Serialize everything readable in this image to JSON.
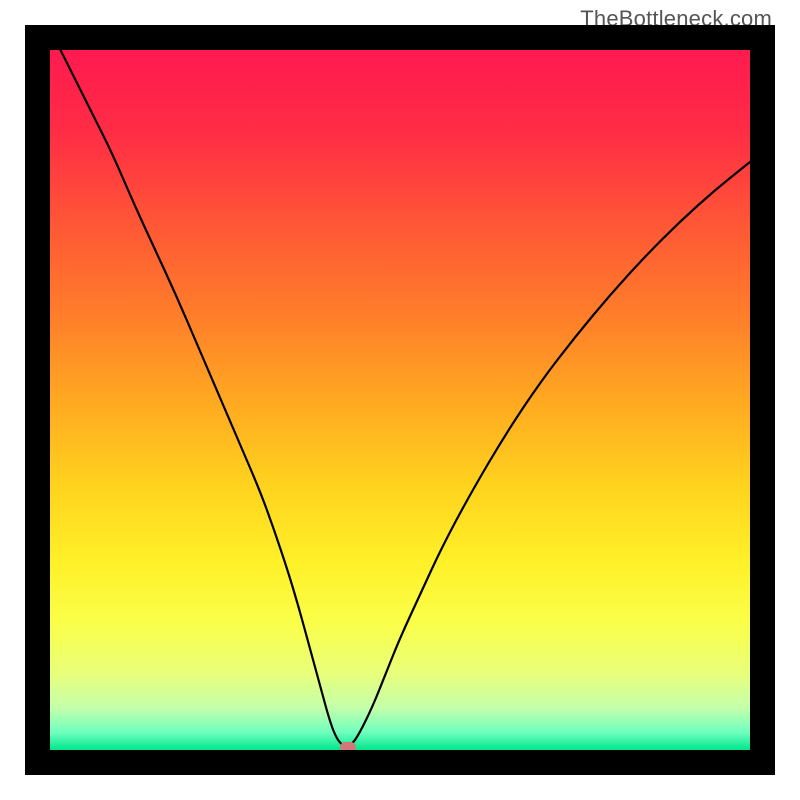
{
  "watermark": "TheBottleneck.com",
  "colors": {
    "frame": "#000000",
    "gradient_stops": [
      {
        "offset": 0.0,
        "color": "#ff1a4f"
      },
      {
        "offset": 0.12,
        "color": "#ff2d45"
      },
      {
        "offset": 0.25,
        "color": "#ff5736"
      },
      {
        "offset": 0.38,
        "color": "#ff7e2a"
      },
      {
        "offset": 0.5,
        "color": "#ffa821"
      },
      {
        "offset": 0.62,
        "color": "#ffd21e"
      },
      {
        "offset": 0.73,
        "color": "#fff028"
      },
      {
        "offset": 0.82,
        "color": "#faff4a"
      },
      {
        "offset": 0.89,
        "color": "#e9ff7a"
      },
      {
        "offset": 0.94,
        "color": "#c4ffab"
      },
      {
        "offset": 0.975,
        "color": "#6effbe"
      },
      {
        "offset": 1.0,
        "color": "#00e68c"
      }
    ],
    "curve": "#000000",
    "marker": "#cf7a77"
  },
  "chart_data": {
    "type": "line",
    "title": "",
    "xlabel": "",
    "ylabel": "",
    "xlim": [
      0,
      100
    ],
    "ylim": [
      0,
      100
    ],
    "series": [
      {
        "name": "bottleneck-curve",
        "x": [
          0,
          3,
          6,
          9,
          12,
          15,
          18,
          21,
          24,
          27,
          30,
          32,
          34,
          35.5,
          37,
          38.5,
          40,
          41,
          42,
          43,
          44,
          46,
          48,
          50,
          53,
          56,
          60,
          65,
          70,
          75,
          80,
          85,
          90,
          95,
          100
        ],
        "y": [
          103,
          97,
          91,
          85,
          78,
          71.5,
          65,
          58,
          51,
          44,
          37,
          31.5,
          25.5,
          20.5,
          15,
          9.5,
          4,
          1.5,
          0.5,
          0.7,
          2,
          6,
          11,
          16,
          22.5,
          29,
          36.5,
          45,
          52.5,
          59,
          65,
          70.5,
          75.5,
          80,
          84
        ]
      }
    ],
    "marker": {
      "x": 42.5,
      "y": 0.5
    },
    "annotations": []
  }
}
